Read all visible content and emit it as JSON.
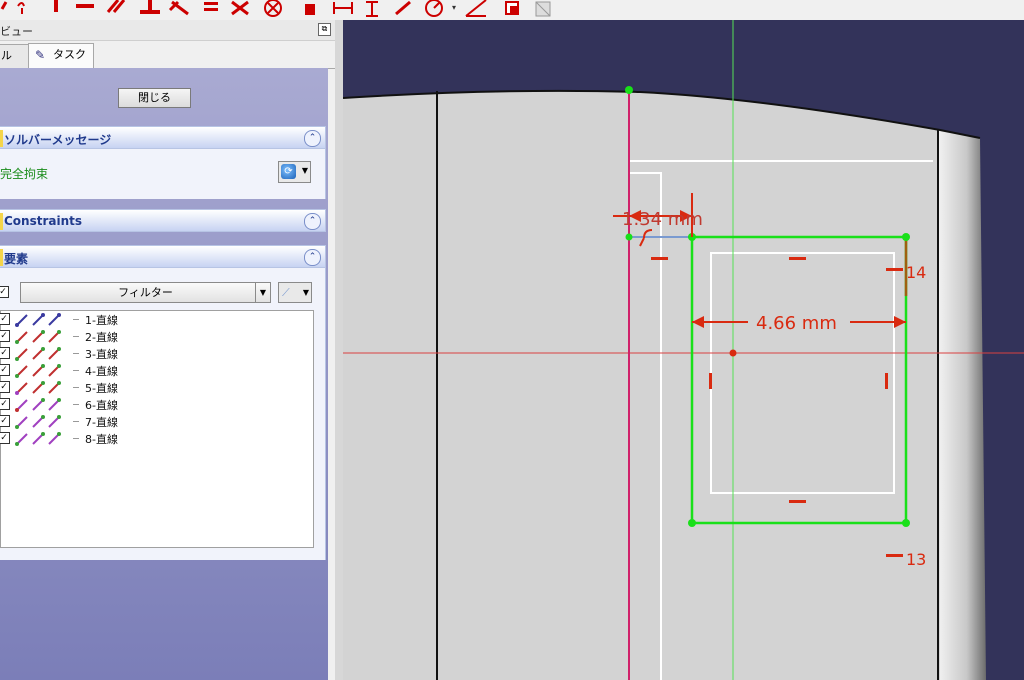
{
  "panel": {
    "title": "ビュー",
    "tabs": [
      {
        "label": "ル"
      },
      {
        "label": "タスク"
      }
    ]
  },
  "task": {
    "close_label": "閉じる",
    "solver": {
      "title": "ソルバーメッセージ",
      "status": "完全拘束"
    },
    "constraints": {
      "title": "Constraints"
    },
    "elements": {
      "title": "要素",
      "filter_label": "フィルター",
      "items": [
        {
          "label": "1-直線"
        },
        {
          "label": "2-直線"
        },
        {
          "label": "3-直線"
        },
        {
          "label": "4-直線"
        },
        {
          "label": "5-直線"
        },
        {
          "label": "6-直線"
        },
        {
          "label": "7-直線"
        },
        {
          "label": "8-直線"
        }
      ]
    }
  },
  "view": {
    "dim_width": "4.66 mm",
    "dim_offset": "1.34 mm",
    "marker_14": "14",
    "marker_13": "13"
  },
  "colors": {
    "accent_red": "#d92a10",
    "sketch_green": "#19e019",
    "axis_red": "#d94040",
    "axis_green": "#55e055",
    "bg_view": "#33335a"
  },
  "icons": [
    "constraint-icons",
    "close-x-icon",
    "refresh-icon",
    "filter-icon",
    "edge-icon"
  ]
}
